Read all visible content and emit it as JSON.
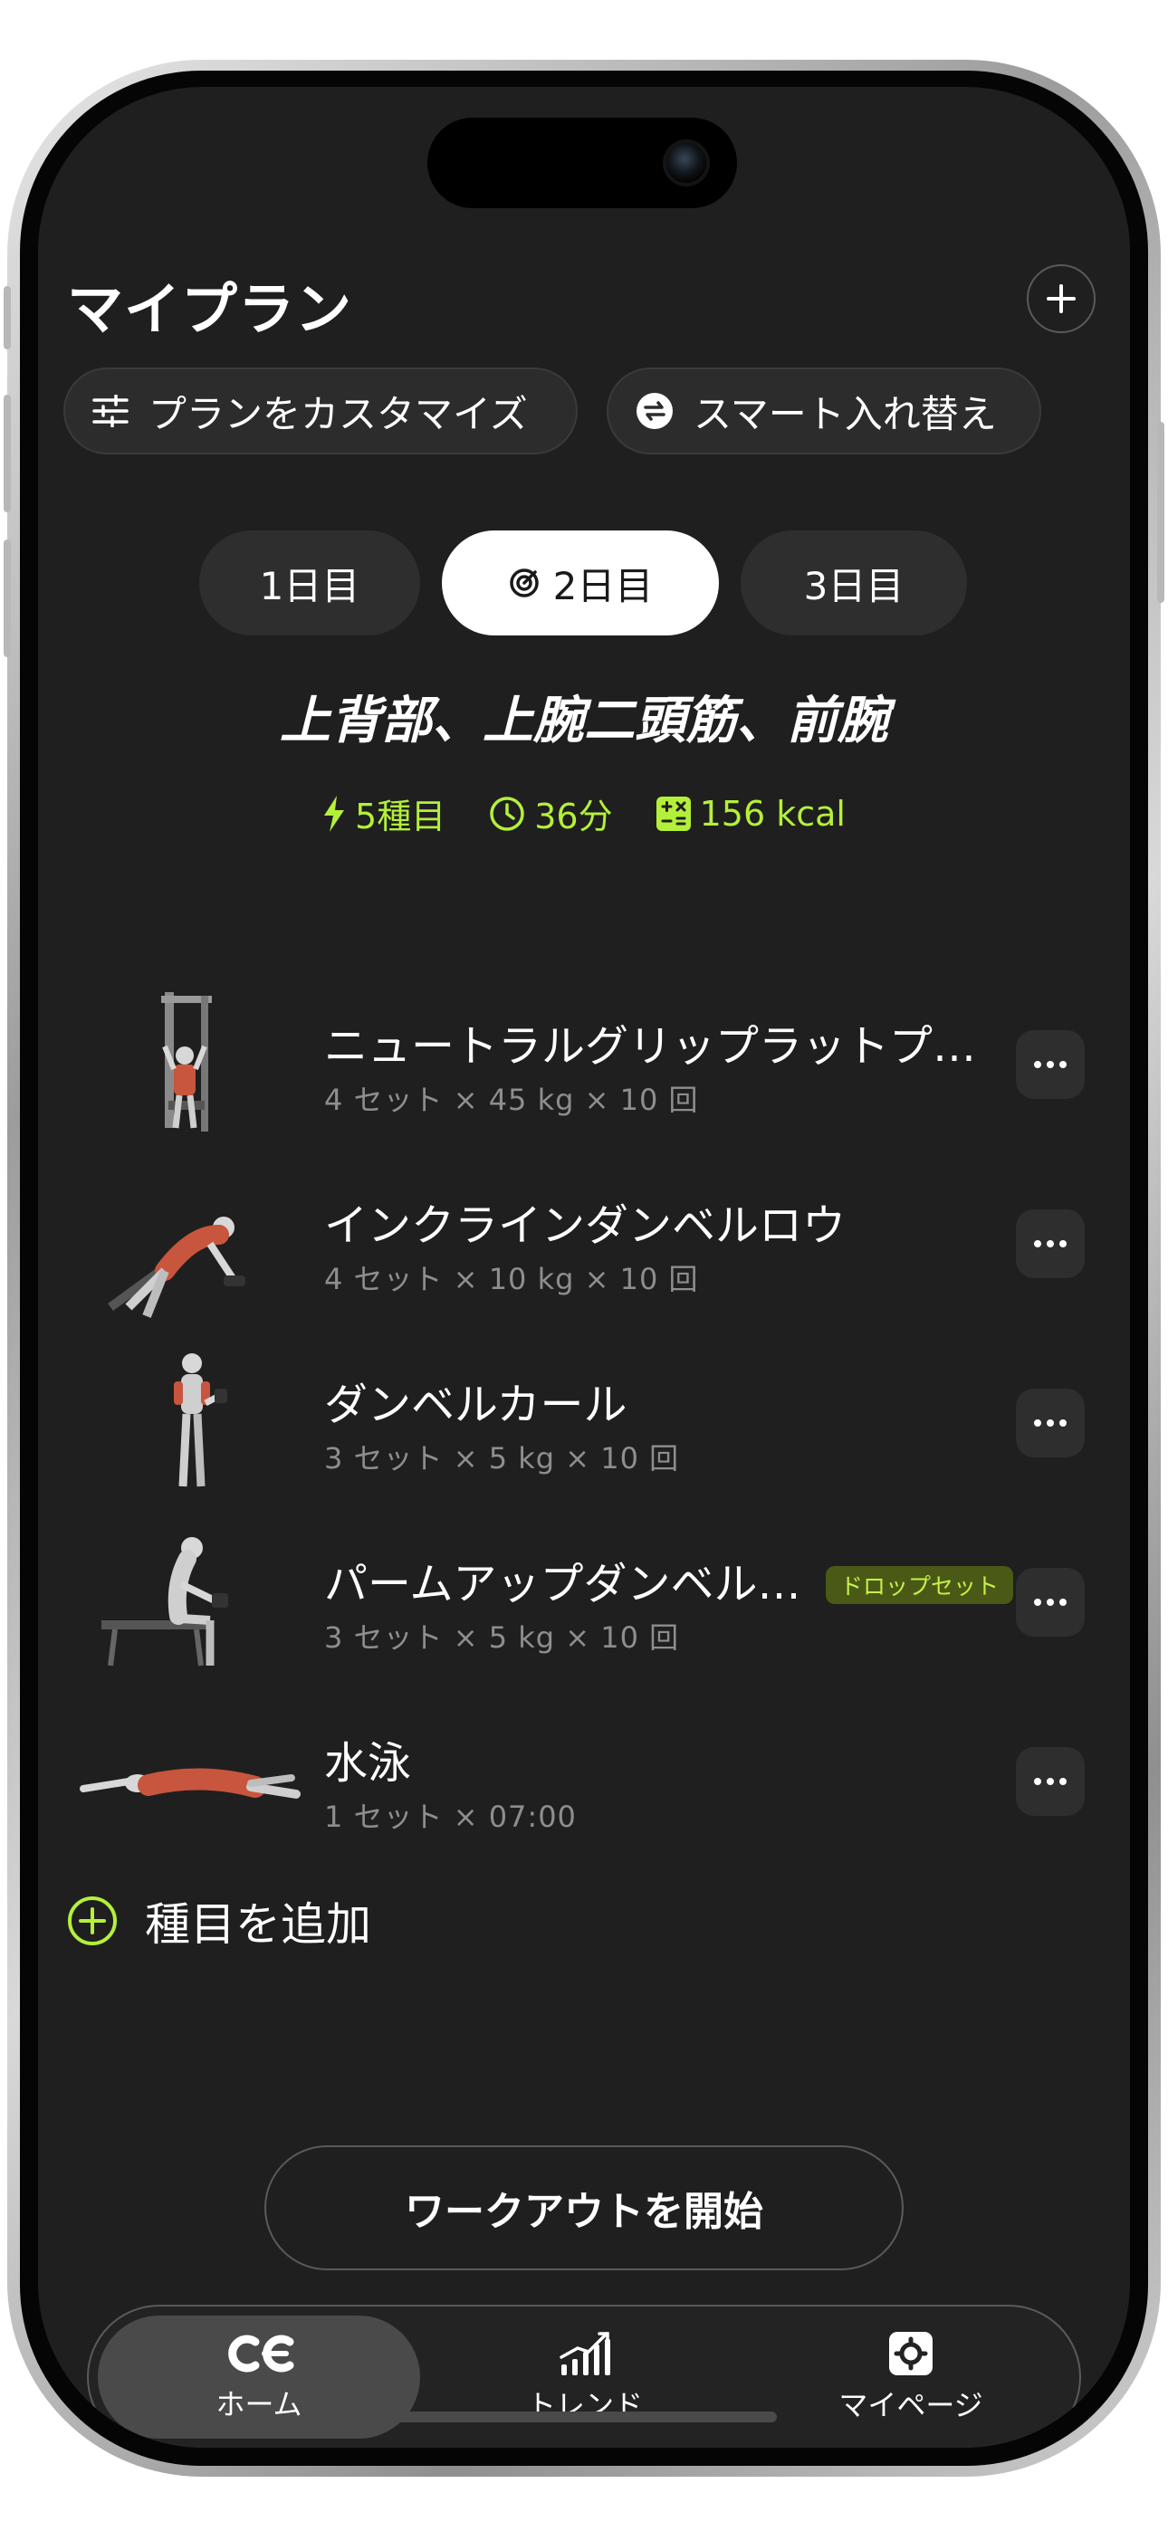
{
  "header": {
    "title": "マイプラン",
    "add_icon": "plus-icon"
  },
  "chips": [
    {
      "label": "プランをカスタマイズ",
      "icon": "sliders-icon"
    },
    {
      "label": "スマート入れ替え",
      "icon": "swap-icon"
    }
  ],
  "days": [
    {
      "label": "1日目",
      "active": false
    },
    {
      "label": "2日目",
      "active": true,
      "icon": "target-icon"
    },
    {
      "label": "3日目",
      "active": false
    }
  ],
  "workout": {
    "title": "上背部、上腕二頭筋、前腕",
    "stats": {
      "exercises": "5種目",
      "duration": "36分",
      "calories": "156 kcal"
    }
  },
  "exercises": [
    {
      "name": "ニュートラルグリップラットプ…",
      "detail": "4 セット × 45 kg × 10 回",
      "badge": ""
    },
    {
      "name": "インクラインダンベルロウ",
      "detail": "4 セット × 10 kg × 10 回",
      "badge": ""
    },
    {
      "name": "ダンベルカール",
      "detail": "3 セット × 5 kg × 10 回",
      "badge": ""
    },
    {
      "name": "パームアップダンベル…",
      "detail": "3 セット × 5 kg × 10 回",
      "badge": "ドロップセット"
    },
    {
      "name": "水泳",
      "detail": "1 セット × 07:00",
      "badge": ""
    }
  ],
  "add_exercise": "種目を追加",
  "start_button": "ワークアウトを開始",
  "tabbar": [
    {
      "label": "ホーム",
      "icon": "home-logo-icon",
      "active": true
    },
    {
      "label": "トレンド",
      "icon": "trend-chart-icon",
      "active": false
    },
    {
      "label": "マイページ",
      "icon": "settings-icon",
      "active": false
    }
  ],
  "colors": {
    "accent": "#b4f03a",
    "background": "#1f1f1f",
    "badge_bg": "#4a5a16"
  }
}
